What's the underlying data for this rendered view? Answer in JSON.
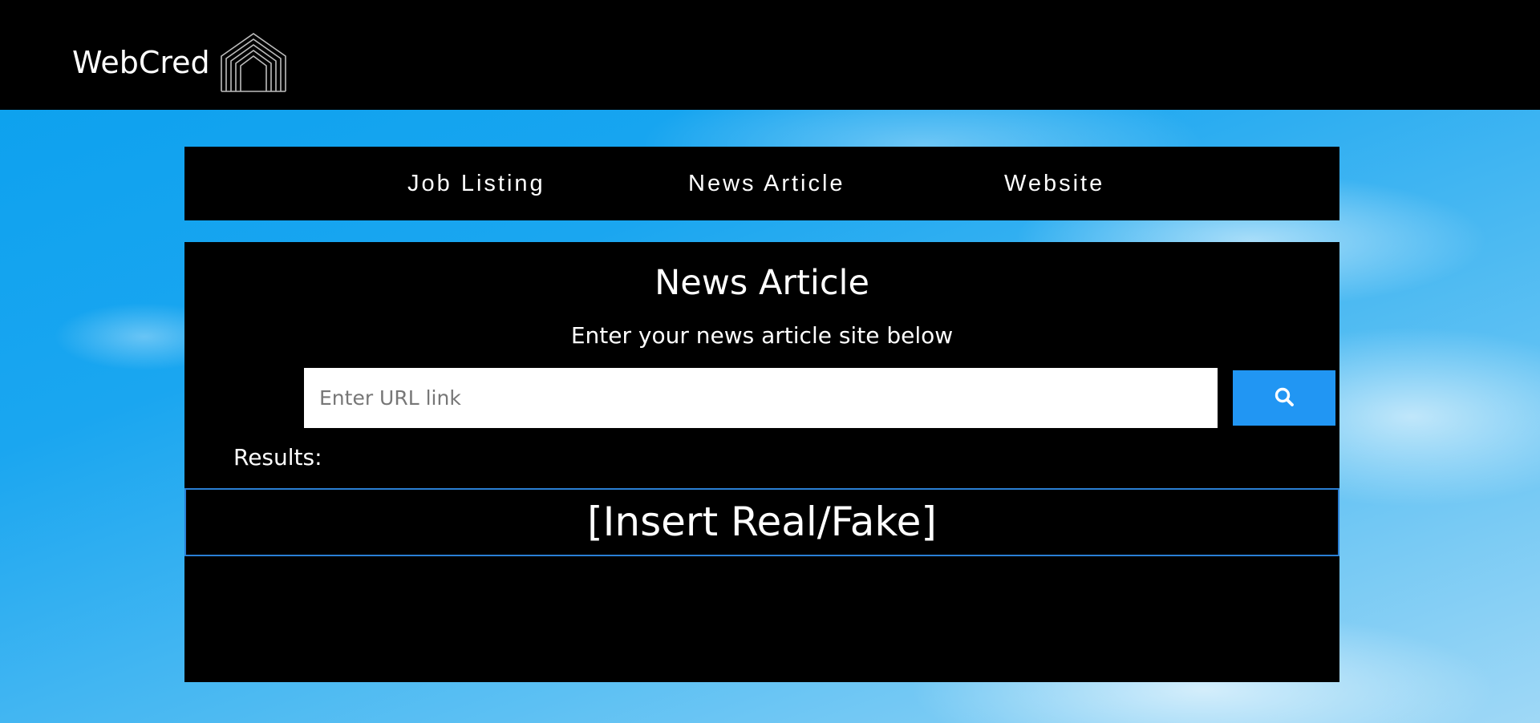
{
  "header": {
    "brand_name": "WebCred",
    "logo_icon": "arch-logo-icon"
  },
  "nav": {
    "items": [
      {
        "label": "Job Listing"
      },
      {
        "label": "News Article"
      },
      {
        "label": "Website"
      }
    ]
  },
  "main": {
    "title": "News Article",
    "subtitle": "Enter your news article site below",
    "search": {
      "placeholder": "Enter URL link",
      "value": "",
      "button_icon": "search-icon"
    },
    "results_label": "Results:",
    "result_text": "[Insert Real/Fake]"
  },
  "colors": {
    "accent": "#2196f3",
    "result_border": "#2a7fd4",
    "panel_bg": "#000000"
  }
}
